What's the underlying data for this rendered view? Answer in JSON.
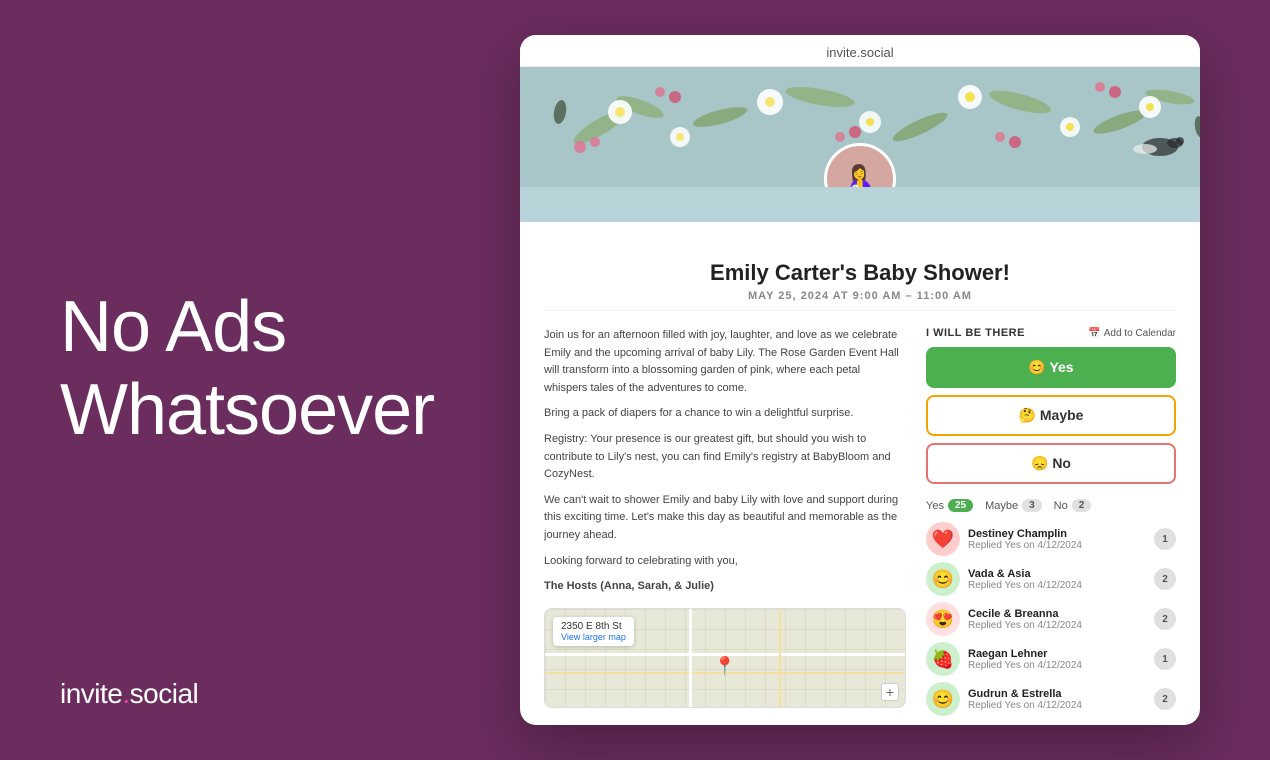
{
  "left": {
    "headline_line1": "No Ads",
    "headline_line2": "Whatsoever",
    "brand": "invite",
    "dot": ".",
    "brand_suffix": "social"
  },
  "app": {
    "domain": "invite.social",
    "event": {
      "title": "Emily Carter's Baby Shower!",
      "date": "MAY 25, 2024 AT 9:00 AM – 11:00 AM",
      "description_1": "Join us for an afternoon filled with joy, laughter, and love as we celebrate Emily and the upcoming arrival of baby Lily. The Rose Garden Event Hall will transform into a blossoming garden of pink, where each petal whispers tales of the adventures to come.",
      "description_2": "Bring a pack of diapers for a chance to win a delightful surprise.",
      "description_3": "Registry: Your presence is our greatest gift, but should you wish to contribute to Lily's nest, you can find Emily's registry at BabyBloom and CozyNest.",
      "description_4": "We can't wait to shower Emily and baby Lily with love and support during this exciting time. Let's make this day as beautiful and memorable as the journey ahead.",
      "description_5": "Looking forward to celebrating with you,",
      "description_6_bold": "The Hosts (Anna, Sarah, & Julie)"
    },
    "rsvp": {
      "label": "I WILL BE THERE",
      "add_calendar": "Add to Calendar",
      "yes_label": "😊 Yes",
      "maybe_label": "🤔 Maybe",
      "no_label": "😞 No",
      "yes_count": "25",
      "maybe_count": "3",
      "no_count": "2"
    },
    "guests": [
      {
        "name": "Destiney Champlin",
        "reply": "Replied Yes on 4/12/2024",
        "emoji": "❤️",
        "count": "1",
        "bg": "#ffcccc"
      },
      {
        "name": "Vada & Asia",
        "reply": "Replied Yes on 4/12/2024",
        "emoji": "😊",
        "count": "2",
        "bg": "#ccf0cc"
      },
      {
        "name": "Cecile & Breanna",
        "reply": "Replied Yes on 4/12/2024",
        "emoji": "😍",
        "count": "2",
        "bg": "#ffe0e0"
      },
      {
        "name": "Raegan Lehner",
        "reply": "Replied Yes on 4/12/2024",
        "emoji": "🍓",
        "count": "1",
        "bg": "#ccf0cc"
      },
      {
        "name": "Gudrun & Estrella",
        "reply": "Replied Yes on 4/12/2024",
        "emoji": "😊",
        "count": "2",
        "bg": "#ccf0cc"
      }
    ],
    "map": {
      "address": "2350 E 8th St",
      "link_text": "View larger map"
    }
  }
}
